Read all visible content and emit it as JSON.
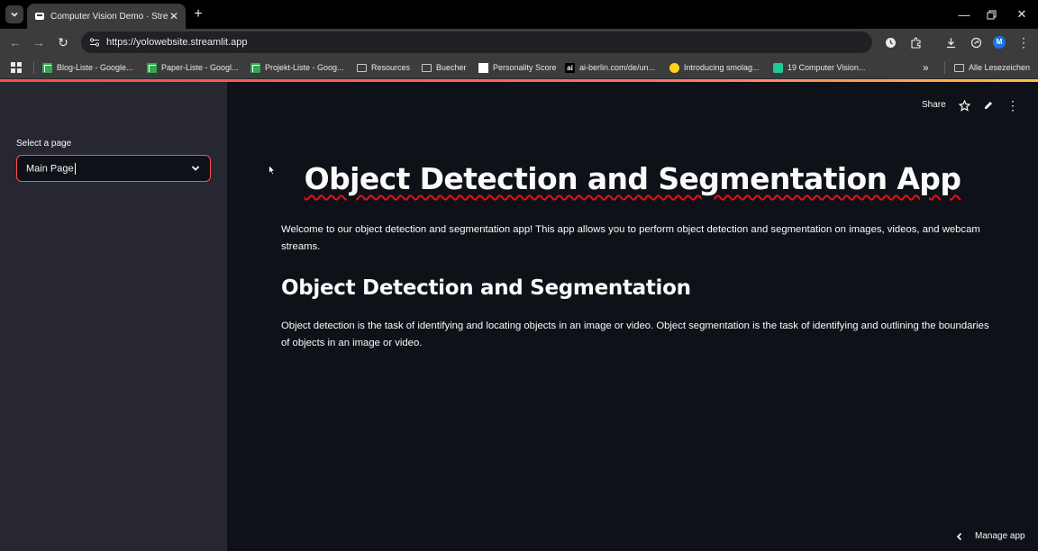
{
  "browser": {
    "tab": {
      "title": "Computer Vision Demo · Streamlit",
      "close_icon": "close-icon"
    },
    "url": "https://yolowebsite.streamlit.app",
    "profile_initial": "M",
    "bookmarks": [
      {
        "label": "Blog-Liste - Google...",
        "icon": "sheet"
      },
      {
        "label": "Paper-Liste - Googl...",
        "icon": "sheet"
      },
      {
        "label": "Projekt-Liste - Goog...",
        "icon": "sheet"
      },
      {
        "label": "Resources",
        "icon": "folder"
      },
      {
        "label": "Buecher",
        "icon": "folder"
      },
      {
        "label": "Personality Score",
        "icon": "white"
      },
      {
        "label": "ai-berlin.com/de/un...",
        "icon": "ai"
      },
      {
        "label": "Introducing smolag...",
        "icon": "hug"
      },
      {
        "label": "19 Computer Vision...",
        "icon": "green"
      }
    ],
    "overflow": "»",
    "all_bookmarks": "Alle Lesezeichen",
    "accent": "#ff4b4b"
  },
  "sidebar": {
    "select_label": "Select a page",
    "select_value": "Main Page"
  },
  "header": {
    "share": "Share"
  },
  "main": {
    "title": "Object Detection and Segmentation App",
    "intro": "Welcome to our object detection and segmentation app! This app allows you to perform object detection and segmentation on images, videos, and webcam streams.",
    "section_title": "Object Detection and Segmentation",
    "section_body": "Object detection is the task of identifying and locating objects in an image or video. Object segmentation is the task of identifying and outlining the boundaries of objects in an image or video."
  },
  "footer": {
    "manage_app": "Manage app"
  }
}
